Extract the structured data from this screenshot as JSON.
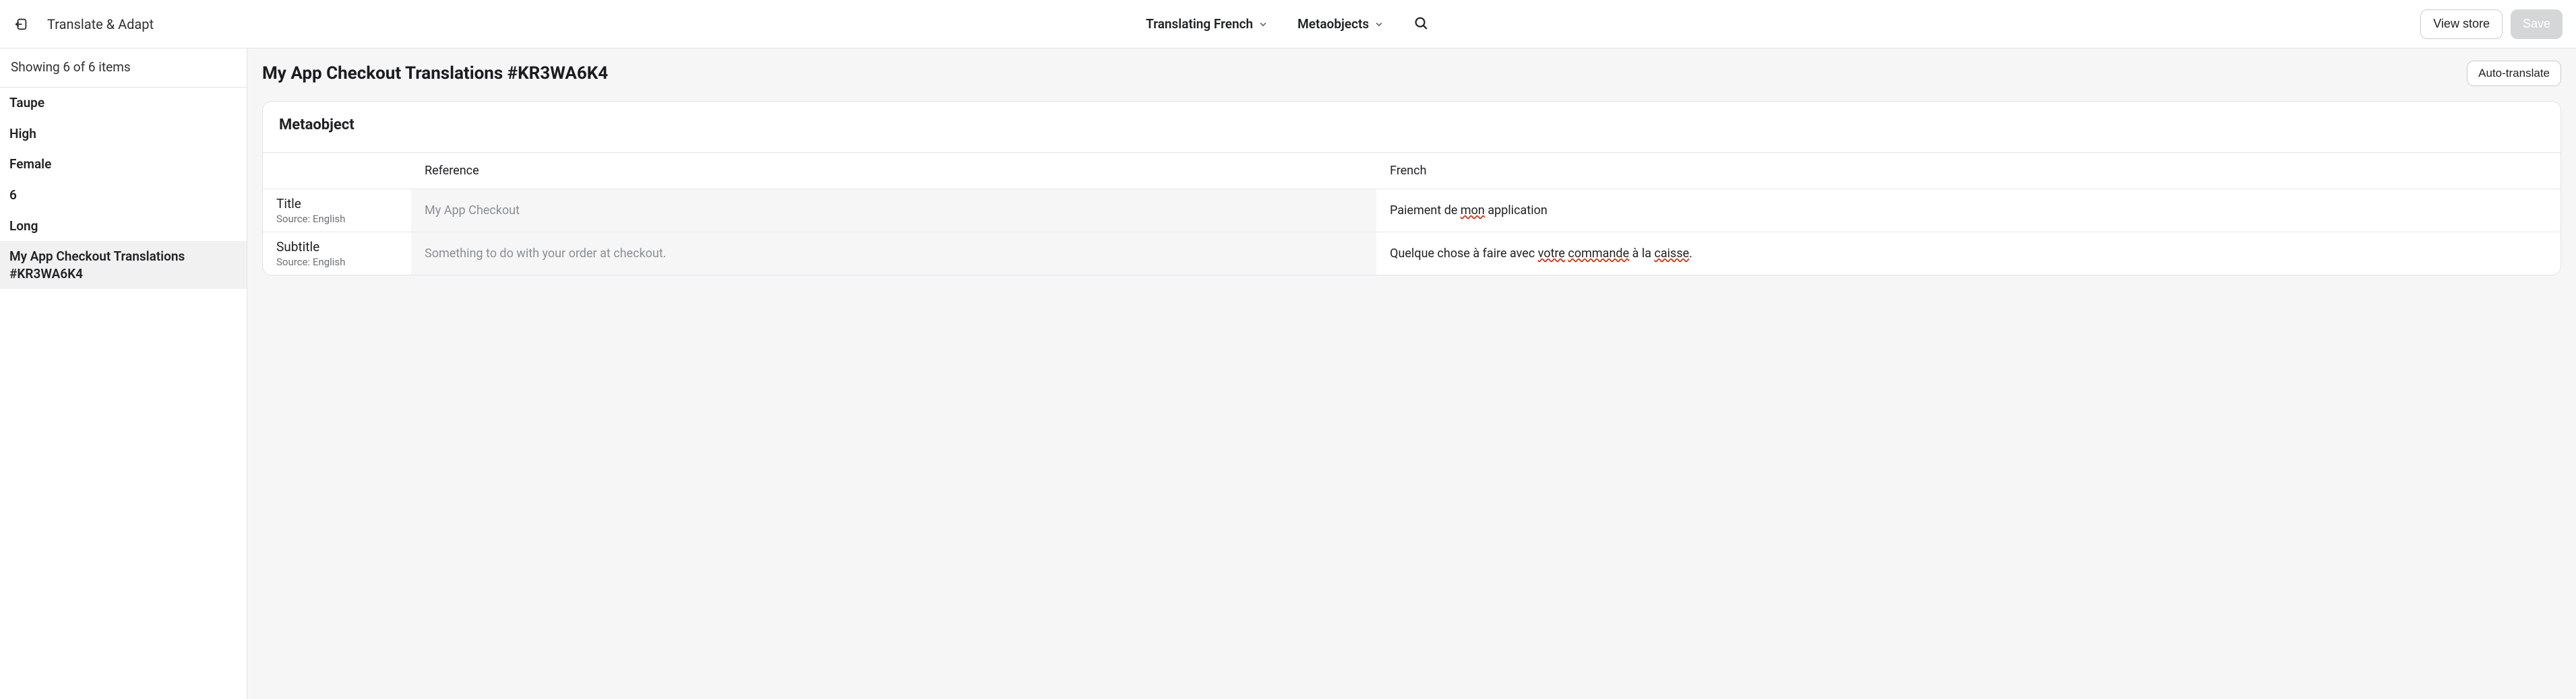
{
  "header": {
    "app_name": "Translate & Adapt",
    "language_dropdown": "Translating French",
    "resource_dropdown": "Metaobjects",
    "view_store": "View store",
    "save": "Save"
  },
  "sidebar": {
    "count_text": "Showing 6 of 6 items",
    "items": [
      {
        "label": "Taupe",
        "selected": false
      },
      {
        "label": "High",
        "selected": false
      },
      {
        "label": "Female",
        "selected": false
      },
      {
        "label": "6",
        "selected": false
      },
      {
        "label": "Long",
        "selected": false
      },
      {
        "label": "My App Checkout Translations #KR3WA6K4",
        "selected": true
      }
    ]
  },
  "page": {
    "title": "My App Checkout Translations #KR3WA6K4",
    "auto_translate": "Auto-translate"
  },
  "card": {
    "title": "Metaobject",
    "columns": {
      "field": "",
      "reference": "Reference",
      "target": "French"
    },
    "source_prefix": "Source: ",
    "source_lang": "English",
    "rows": [
      {
        "field": "Title",
        "reference": "My App Checkout",
        "target_parts": [
          {
            "t": "Paiement de "
          },
          {
            "t": "mon",
            "err": true
          },
          {
            "t": " application"
          }
        ]
      },
      {
        "field": "Subtitle",
        "reference": "Something to do with your order at checkout.",
        "target_parts": [
          {
            "t": "Quelque chose à faire avec "
          },
          {
            "t": "votre",
            "err": true
          },
          {
            "t": " "
          },
          {
            "t": "commande",
            "err": true
          },
          {
            "t": " à la "
          },
          {
            "t": "caisse",
            "err": true
          },
          {
            "t": "."
          }
        ]
      }
    ]
  }
}
